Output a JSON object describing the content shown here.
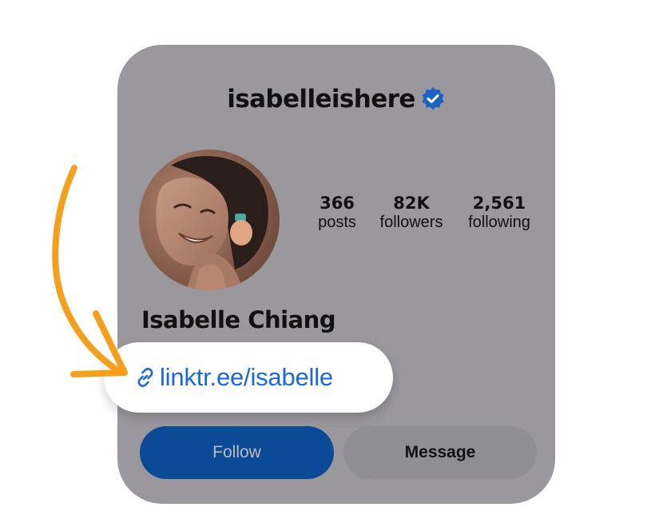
{
  "profile": {
    "username": "isabelleishere",
    "display_name": "Isabelle Chiang",
    "verified_icon": "verified-badge-icon",
    "avatar_icon": "profile-photo",
    "stats": {
      "posts_count": "366",
      "posts_label": "posts",
      "followers_count": "82K",
      "followers_label": "followers",
      "following_count": "2,561",
      "following_label": "following"
    },
    "link": {
      "icon": "link-icon",
      "text": "linktr.ee/isabelle"
    },
    "buttons": {
      "follow_label": "Follow",
      "message_label": "Message"
    }
  },
  "colors": {
    "card_bg": "#9a989c",
    "verified": "#1a63c4",
    "link": "#1b6ad3",
    "follow_bg": "#0a4a96",
    "message_bg": "#8f8e93",
    "arrow": "#f4a01c"
  }
}
